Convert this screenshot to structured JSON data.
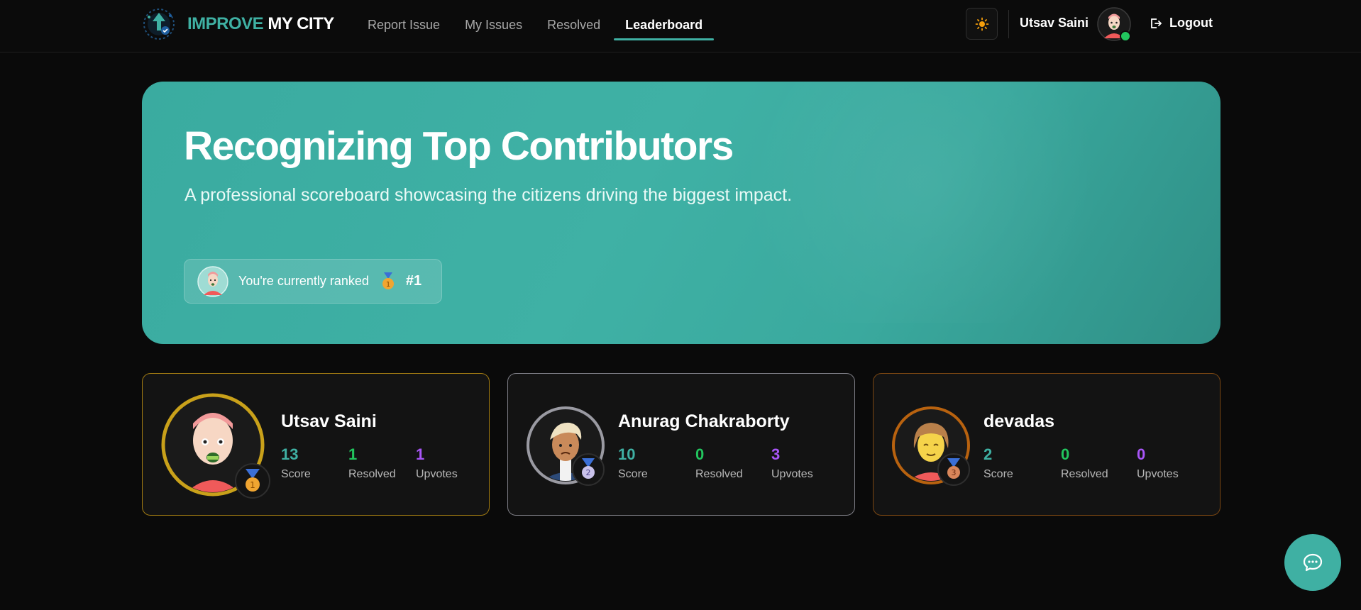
{
  "brand": {
    "part1": "IMPROVE",
    "part2": "MY CITY",
    "logo_icon": "city-upload-logo-icon"
  },
  "nav": {
    "items": [
      {
        "label": "Report Issue",
        "active": false
      },
      {
        "label": "My Issues",
        "active": false
      },
      {
        "label": "Resolved",
        "active": false
      },
      {
        "label": "Leaderboard",
        "active": true
      }
    ]
  },
  "header": {
    "theme_icon": "sun-icon",
    "user_name": "Utsav Saini",
    "logout_label": "Logout",
    "logout_icon": "logout-icon",
    "online": true
  },
  "hero": {
    "title": "Recognizing Top Contributors",
    "subtitle": "A professional scoreboard showcasing the citizens driving the biggest impact.",
    "rank_text": "You're currently ranked",
    "rank_value": "#1",
    "rank_medal": "1"
  },
  "leaders": [
    {
      "name": "Utsav Saini",
      "medal": "1",
      "score": "13",
      "score_label": "Score",
      "resolved": "1",
      "resolved_label": "Resolved",
      "upvotes": "1",
      "upvotes_label": "Upvotes"
    },
    {
      "name": "Anurag Chakraborty",
      "medal": "2",
      "score": "10",
      "score_label": "Score",
      "resolved": "0",
      "resolved_label": "Resolved",
      "upvotes": "3",
      "upvotes_label": "Upvotes"
    },
    {
      "name": "devadas",
      "medal": "3",
      "score": "2",
      "score_label": "Score",
      "resolved": "0",
      "resolved_label": "Resolved",
      "upvotes": "0",
      "upvotes_label": "Upvotes"
    }
  ],
  "colors": {
    "accent": "#3fb0a3",
    "gold": "#c9a11a",
    "silver": "#9a9aa2",
    "bronze": "#b8620f",
    "resolved": "#22c55e",
    "upvotes": "#a855f7"
  },
  "chat_icon": "chat-bubble-icon"
}
